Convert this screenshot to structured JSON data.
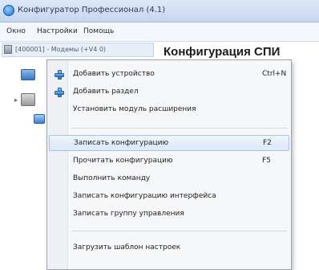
{
  "window": {
    "title": "Конфигуратор Профессионал (4.1)"
  },
  "menubar": {
    "items": [
      "Окно",
      "Настройки",
      "Помощь"
    ]
  },
  "tree": {
    "top_node_label": "[400001] - Модемы (+V4 0)"
  },
  "content": {
    "heading": "Конфигурация СПИ"
  },
  "context_menu": {
    "items": [
      {
        "label": "Добавить устройство",
        "shortcut": "Ctrl+N",
        "icon": "plus-icon"
      },
      {
        "label": "Добавить раздел",
        "shortcut": "",
        "icon": "plus-icon"
      },
      {
        "label": "Установить модуль расширения",
        "shortcut": ""
      },
      {
        "label": "Записать конфигурацию",
        "shortcut": "F2",
        "highlighted": true
      },
      {
        "label": "Прочитать конфигурацию",
        "shortcut": "F5"
      },
      {
        "label": "Выполнить команду",
        "shortcut": ""
      },
      {
        "label": "Записать конфигурацию интерфейса",
        "shortcut": ""
      },
      {
        "label": "Записать группу управления",
        "shortcut": ""
      },
      {
        "label": "Загрузить шаблон настроек",
        "shortcut": ""
      }
    ]
  },
  "colors": {
    "highlight": "#dce8f7",
    "menu_background": "#f6f7f9"
  }
}
